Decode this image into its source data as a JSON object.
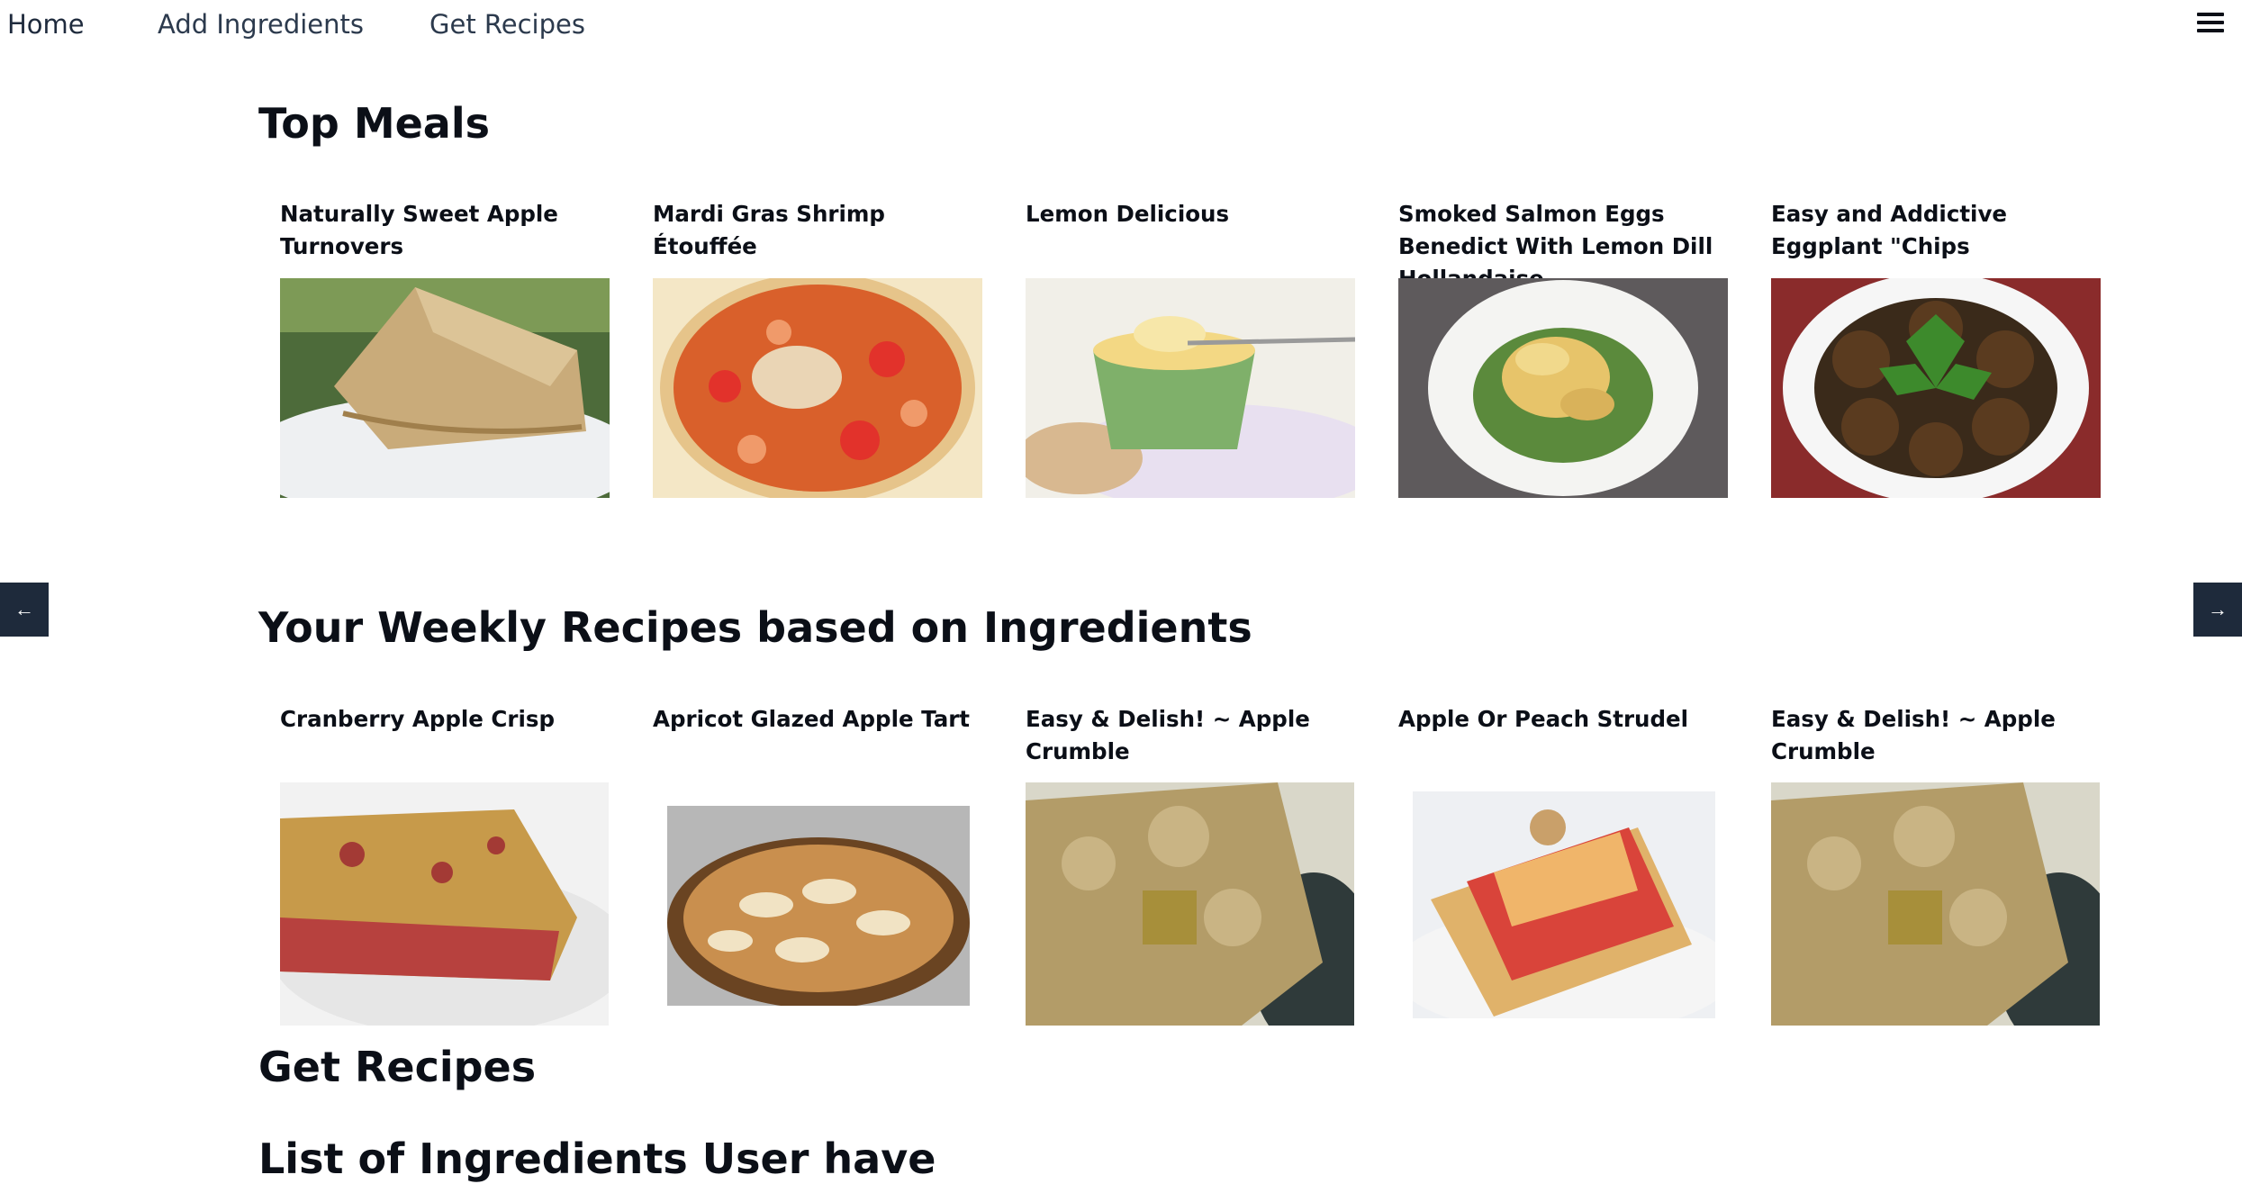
{
  "nav": {
    "home": "Home",
    "add_ingredients": "Add Ingredients",
    "get_recipes": "Get Recipes",
    "menu_icon": "hamburger-menu-icon"
  },
  "sections": {
    "top_meals": "Top Meals",
    "weekly": "Your Weekly Recipes based on Ingredients",
    "get_recipes": "Get Recipes",
    "ingredients_list": "List of Ingredients User have"
  },
  "top_meals": [
    {
      "title": "Naturally Sweet Apple Turnovers",
      "image": "apple-turnovers-photo"
    },
    {
      "title": "Mardi Gras Shrimp Étouffée",
      "image": "shrimp-etouffee-photo"
    },
    {
      "title": "Lemon Delicious",
      "image": "lemon-delicious-photo"
    },
    {
      "title": "Smoked Salmon Eggs Benedict With Lemon Dill Hollandaise",
      "image": "eggs-benedict-photo"
    },
    {
      "title": "Easy and Addictive Eggplant \"Chips",
      "image": "eggplant-chips-photo"
    }
  ],
  "weekly_recipes": [
    {
      "title": "Cranberry Apple Crisp",
      "image": "cranberry-apple-crisp-photo"
    },
    {
      "title": "Apricot Glazed Apple Tart",
      "image": "apple-tart-photo"
    },
    {
      "title": "Easy & Delish! ~ Apple Crumble",
      "image": "apple-crumble-photo"
    },
    {
      "title": "Apple Or Peach Strudel",
      "image": "peach-strudel-photo"
    },
    {
      "title": "Easy & Delish! ~ Apple Crumble",
      "image": "apple-crumble-photo"
    }
  ],
  "carousel": {
    "prev_label": "←",
    "next_label": "→"
  },
  "colors": {
    "nav_text": "#2c3a4d",
    "arrow_bg": "#1e2a3b",
    "heading": "#0b0f17"
  }
}
